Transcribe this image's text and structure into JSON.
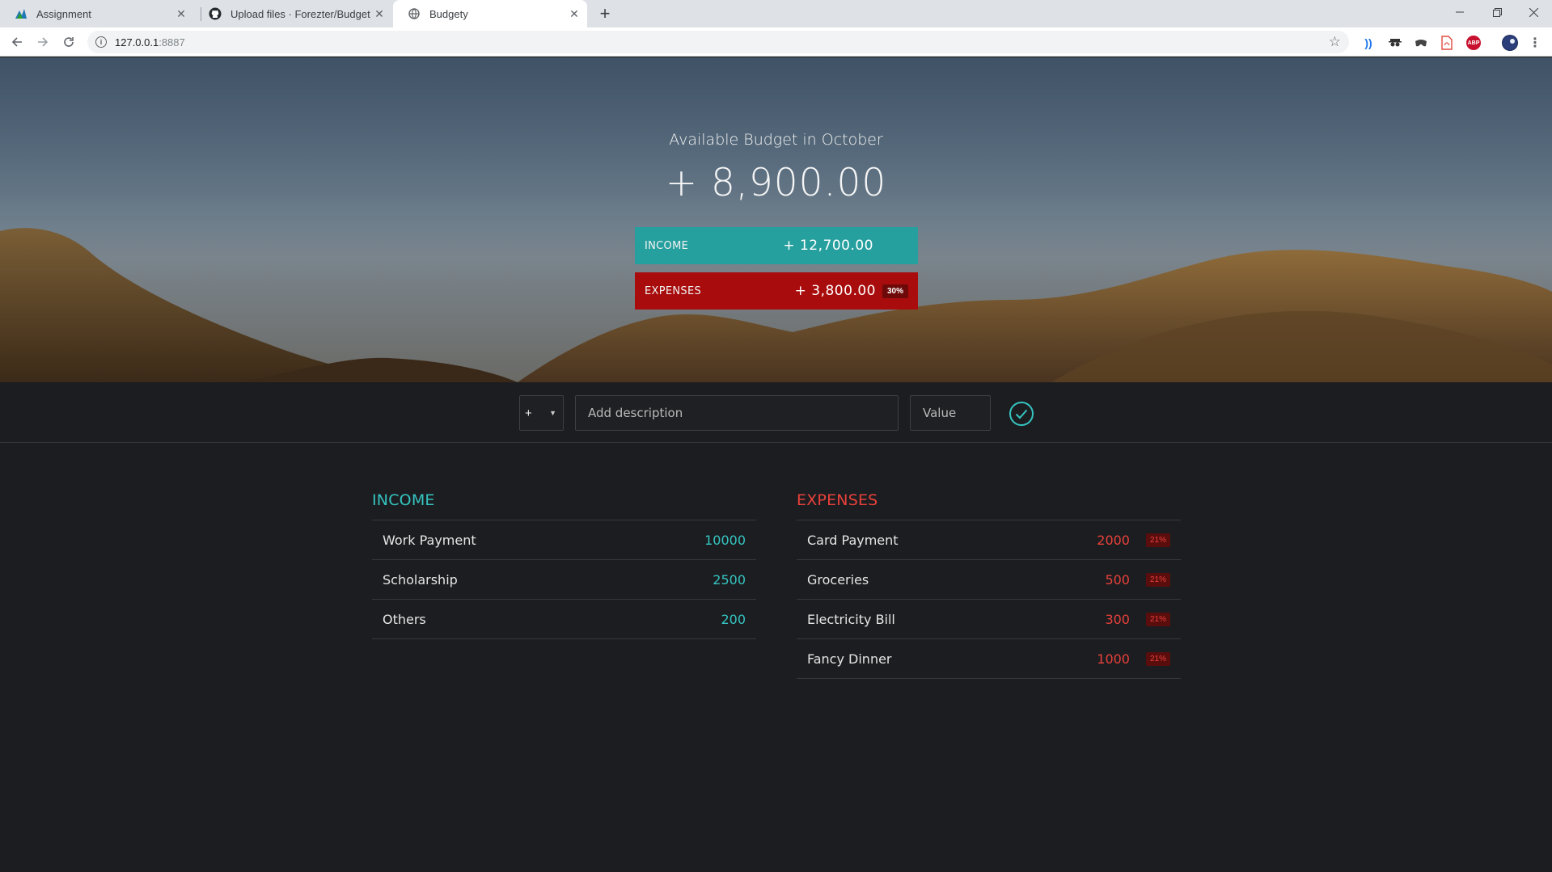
{
  "browser": {
    "tabs": [
      {
        "title": "Assignment",
        "icon": "mathworks-icon",
        "active": false
      },
      {
        "title": "Upload files · Forezter/Budget",
        "icon": "github-icon",
        "active": false
      },
      {
        "title": "Budgety",
        "icon": "globe-icon",
        "active": true
      }
    ],
    "new_tab": "+",
    "url_host": "127.0.0.1",
    "url_port": ":8887",
    "extensions": [
      "wifi-icon",
      "spy-icon",
      "gamepad-icon",
      "pdf-icon",
      "abp-icon"
    ],
    "abp_label": "ABP"
  },
  "budget": {
    "title": "Available Budget in October",
    "value": "+ 8,900.00",
    "income_label": "INCOME",
    "income_value": "+ 12,700.00",
    "expenses_label": "EXPENSES",
    "expenses_value": "+ 3,800.00",
    "expenses_percentage": "30%"
  },
  "add_form": {
    "type_value": "+",
    "description_placeholder": "Add description",
    "value_placeholder": "Value"
  },
  "income": {
    "title": "INCOME",
    "items": [
      {
        "description": "Work Payment",
        "value": "10000"
      },
      {
        "description": "Scholarship",
        "value": "2500"
      },
      {
        "description": "Others",
        "value": "200"
      }
    ]
  },
  "expenses": {
    "title": "EXPENSES",
    "items": [
      {
        "description": "Card Payment",
        "value": "2000",
        "percentage": "21%"
      },
      {
        "description": "Groceries",
        "value": "500",
        "percentage": "21%"
      },
      {
        "description": "Electricity Bill",
        "value": "300",
        "percentage": "21%"
      },
      {
        "description": "Fancy Dinner",
        "value": "1000",
        "percentage": "21%"
      }
    ]
  },
  "colors": {
    "income_accent": "#26a09e",
    "expense_accent": "#a90c0c",
    "income_text": "#35c4c1",
    "expense_text": "#e9413b",
    "page_bg": "#1c1d20"
  }
}
